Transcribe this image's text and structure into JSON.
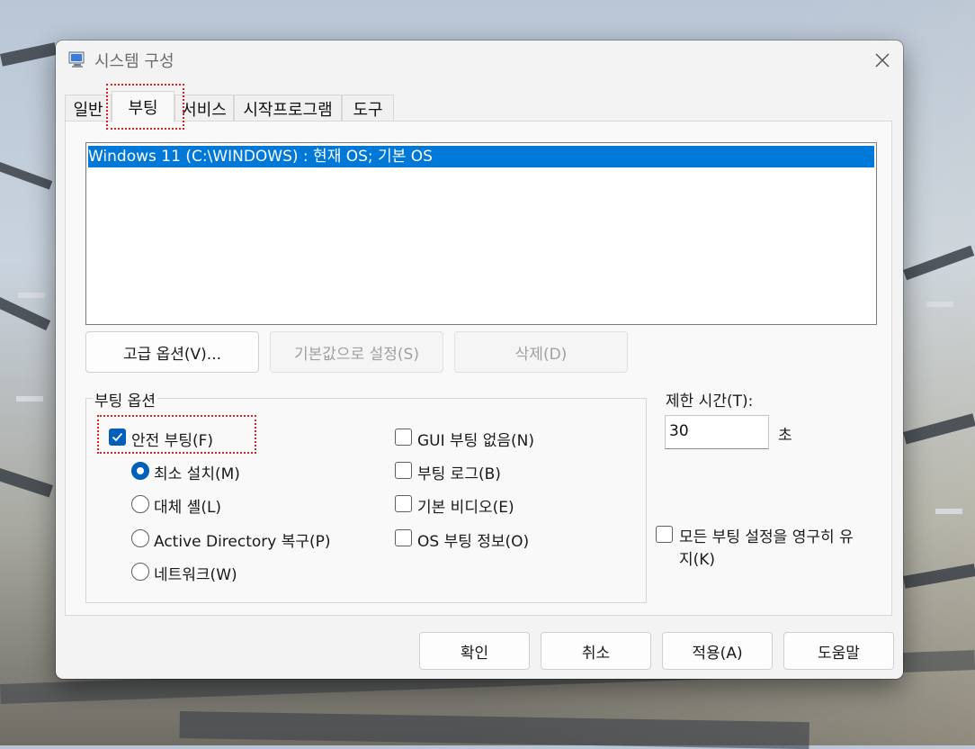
{
  "window": {
    "title": "시스템 구성"
  },
  "tabs": [
    {
      "label": "일반"
    },
    {
      "label": "부팅"
    },
    {
      "label": "서비스"
    },
    {
      "label": "시작프로그램"
    },
    {
      "label": "도구"
    }
  ],
  "active_tab": "부팅",
  "os_list": {
    "items": [
      "Windows 11 (C:\\WINDOWS) : 현재 OS; 기본 OS"
    ]
  },
  "buttons": {
    "advanced": "고급 옵션(V)...",
    "set_default": "기본값으로 설정(S)",
    "delete": "삭제(D)"
  },
  "boot_options": {
    "group_label": "부팅 옵션",
    "safe_boot": {
      "label": "안전 부팅(F)",
      "checked": true
    },
    "modes": [
      {
        "label": "최소 설치(M)",
        "selected": true
      },
      {
        "label": "대체 셸(L)",
        "selected": false
      },
      {
        "label": "Active Directory 복구(P)",
        "selected": false
      },
      {
        "label": "네트워크(W)",
        "selected": false
      }
    ],
    "flags": [
      {
        "label": "GUI 부팅 없음(N)",
        "checked": false
      },
      {
        "label": "부팅 로그(B)",
        "checked": false
      },
      {
        "label": "기본 비디오(E)",
        "checked": false
      },
      {
        "label": "OS 부팅 정보(O)",
        "checked": false
      }
    ]
  },
  "timeout": {
    "label": "제한 시간(T):",
    "value": "30",
    "unit": "초"
  },
  "permanent": {
    "label_line1": "모든 부팅 설정을 영구히 유",
    "label_line2": "지(K)",
    "checked": false
  },
  "footer": {
    "ok": "확인",
    "cancel": "취소",
    "apply": "적용(A)",
    "help": "도움말"
  },
  "colors": {
    "accent": "#005fb8",
    "selection": "#0078d7",
    "highlight": "#e02020"
  }
}
